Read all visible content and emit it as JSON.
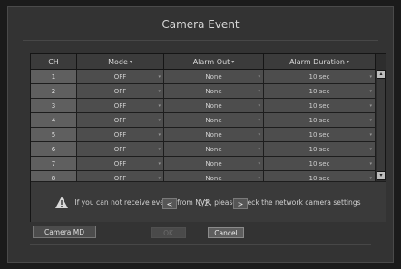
{
  "dialog": {
    "title": "Camera Event"
  },
  "table": {
    "headers": {
      "ch": "CH",
      "mode": "Mode",
      "alarm_out": "Alarm Out",
      "alarm_duration": "Alarm Duration"
    },
    "rows": [
      {
        "ch": "1",
        "mode": "OFF",
        "alarm_out": "None",
        "alarm_duration": "10 sec"
      },
      {
        "ch": "2",
        "mode": "OFF",
        "alarm_out": "None",
        "alarm_duration": "10 sec"
      },
      {
        "ch": "3",
        "mode": "OFF",
        "alarm_out": "None",
        "alarm_duration": "10 sec"
      },
      {
        "ch": "4",
        "mode": "OFF",
        "alarm_out": "None",
        "alarm_duration": "10 sec"
      },
      {
        "ch": "5",
        "mode": "OFF",
        "alarm_out": "None",
        "alarm_duration": "10 sec"
      },
      {
        "ch": "6",
        "mode": "OFF",
        "alarm_out": "None",
        "alarm_duration": "10 sec"
      },
      {
        "ch": "7",
        "mode": "OFF",
        "alarm_out": "None",
        "alarm_duration": "10 sec"
      },
      {
        "ch": "8",
        "mode": "OFF",
        "alarm_out": "None",
        "alarm_duration": "10 sec"
      }
    ]
  },
  "notice": {
    "icon": "warning-triangle-icon",
    "text": "If you can not receive events from NVR, please check the network camera settings"
  },
  "buttons": {
    "camera_md": "Camera MD",
    "ok": "OK",
    "cancel": "Cancel"
  },
  "pagination": {
    "label": "1/2",
    "prev": "<",
    "next": ">"
  },
  "colors": {
    "background": "#333333",
    "row_cell": "#4d4d4d",
    "channel_cell": "#5f5f5f"
  }
}
